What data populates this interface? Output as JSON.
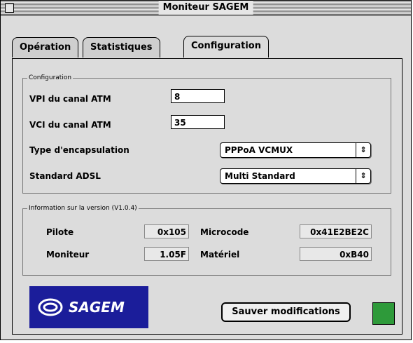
{
  "window": {
    "title": "Moniteur SAGEM"
  },
  "tabs": [
    {
      "label": "Opération"
    },
    {
      "label": "Statistiques"
    },
    {
      "label": "Configuration",
      "active": true
    }
  ],
  "configuration_group": {
    "legend": "Configuration",
    "vpi": {
      "label": "VPI du canal ATM",
      "value": "8"
    },
    "vci": {
      "label": "VCI du canal ATM",
      "value": "35"
    },
    "encapsulation": {
      "label": "Type d'encapsulation",
      "value": "PPPoA VCMUX"
    },
    "adsl": {
      "label": "Standard ADSL",
      "value": "Multi Standard"
    },
    "select_arrow_icon": "up-down-arrows-icon"
  },
  "version_group": {
    "legend": "Information sur la version (V1.0.4)",
    "pilote": {
      "label": "Pilote",
      "value": "0x105"
    },
    "microcode": {
      "label": "Microcode",
      "value": "0x41E2BE2C"
    },
    "moniteur": {
      "label": "Moniteur",
      "value": "1.05F"
    },
    "materiel": {
      "label": "Matériel",
      "value": "0xB40"
    }
  },
  "footer": {
    "logo_text": "SAGEM",
    "save_button": "Sauver modifications",
    "status_color": "#2e9a3a",
    "logo_color": "#1b1d9a"
  }
}
